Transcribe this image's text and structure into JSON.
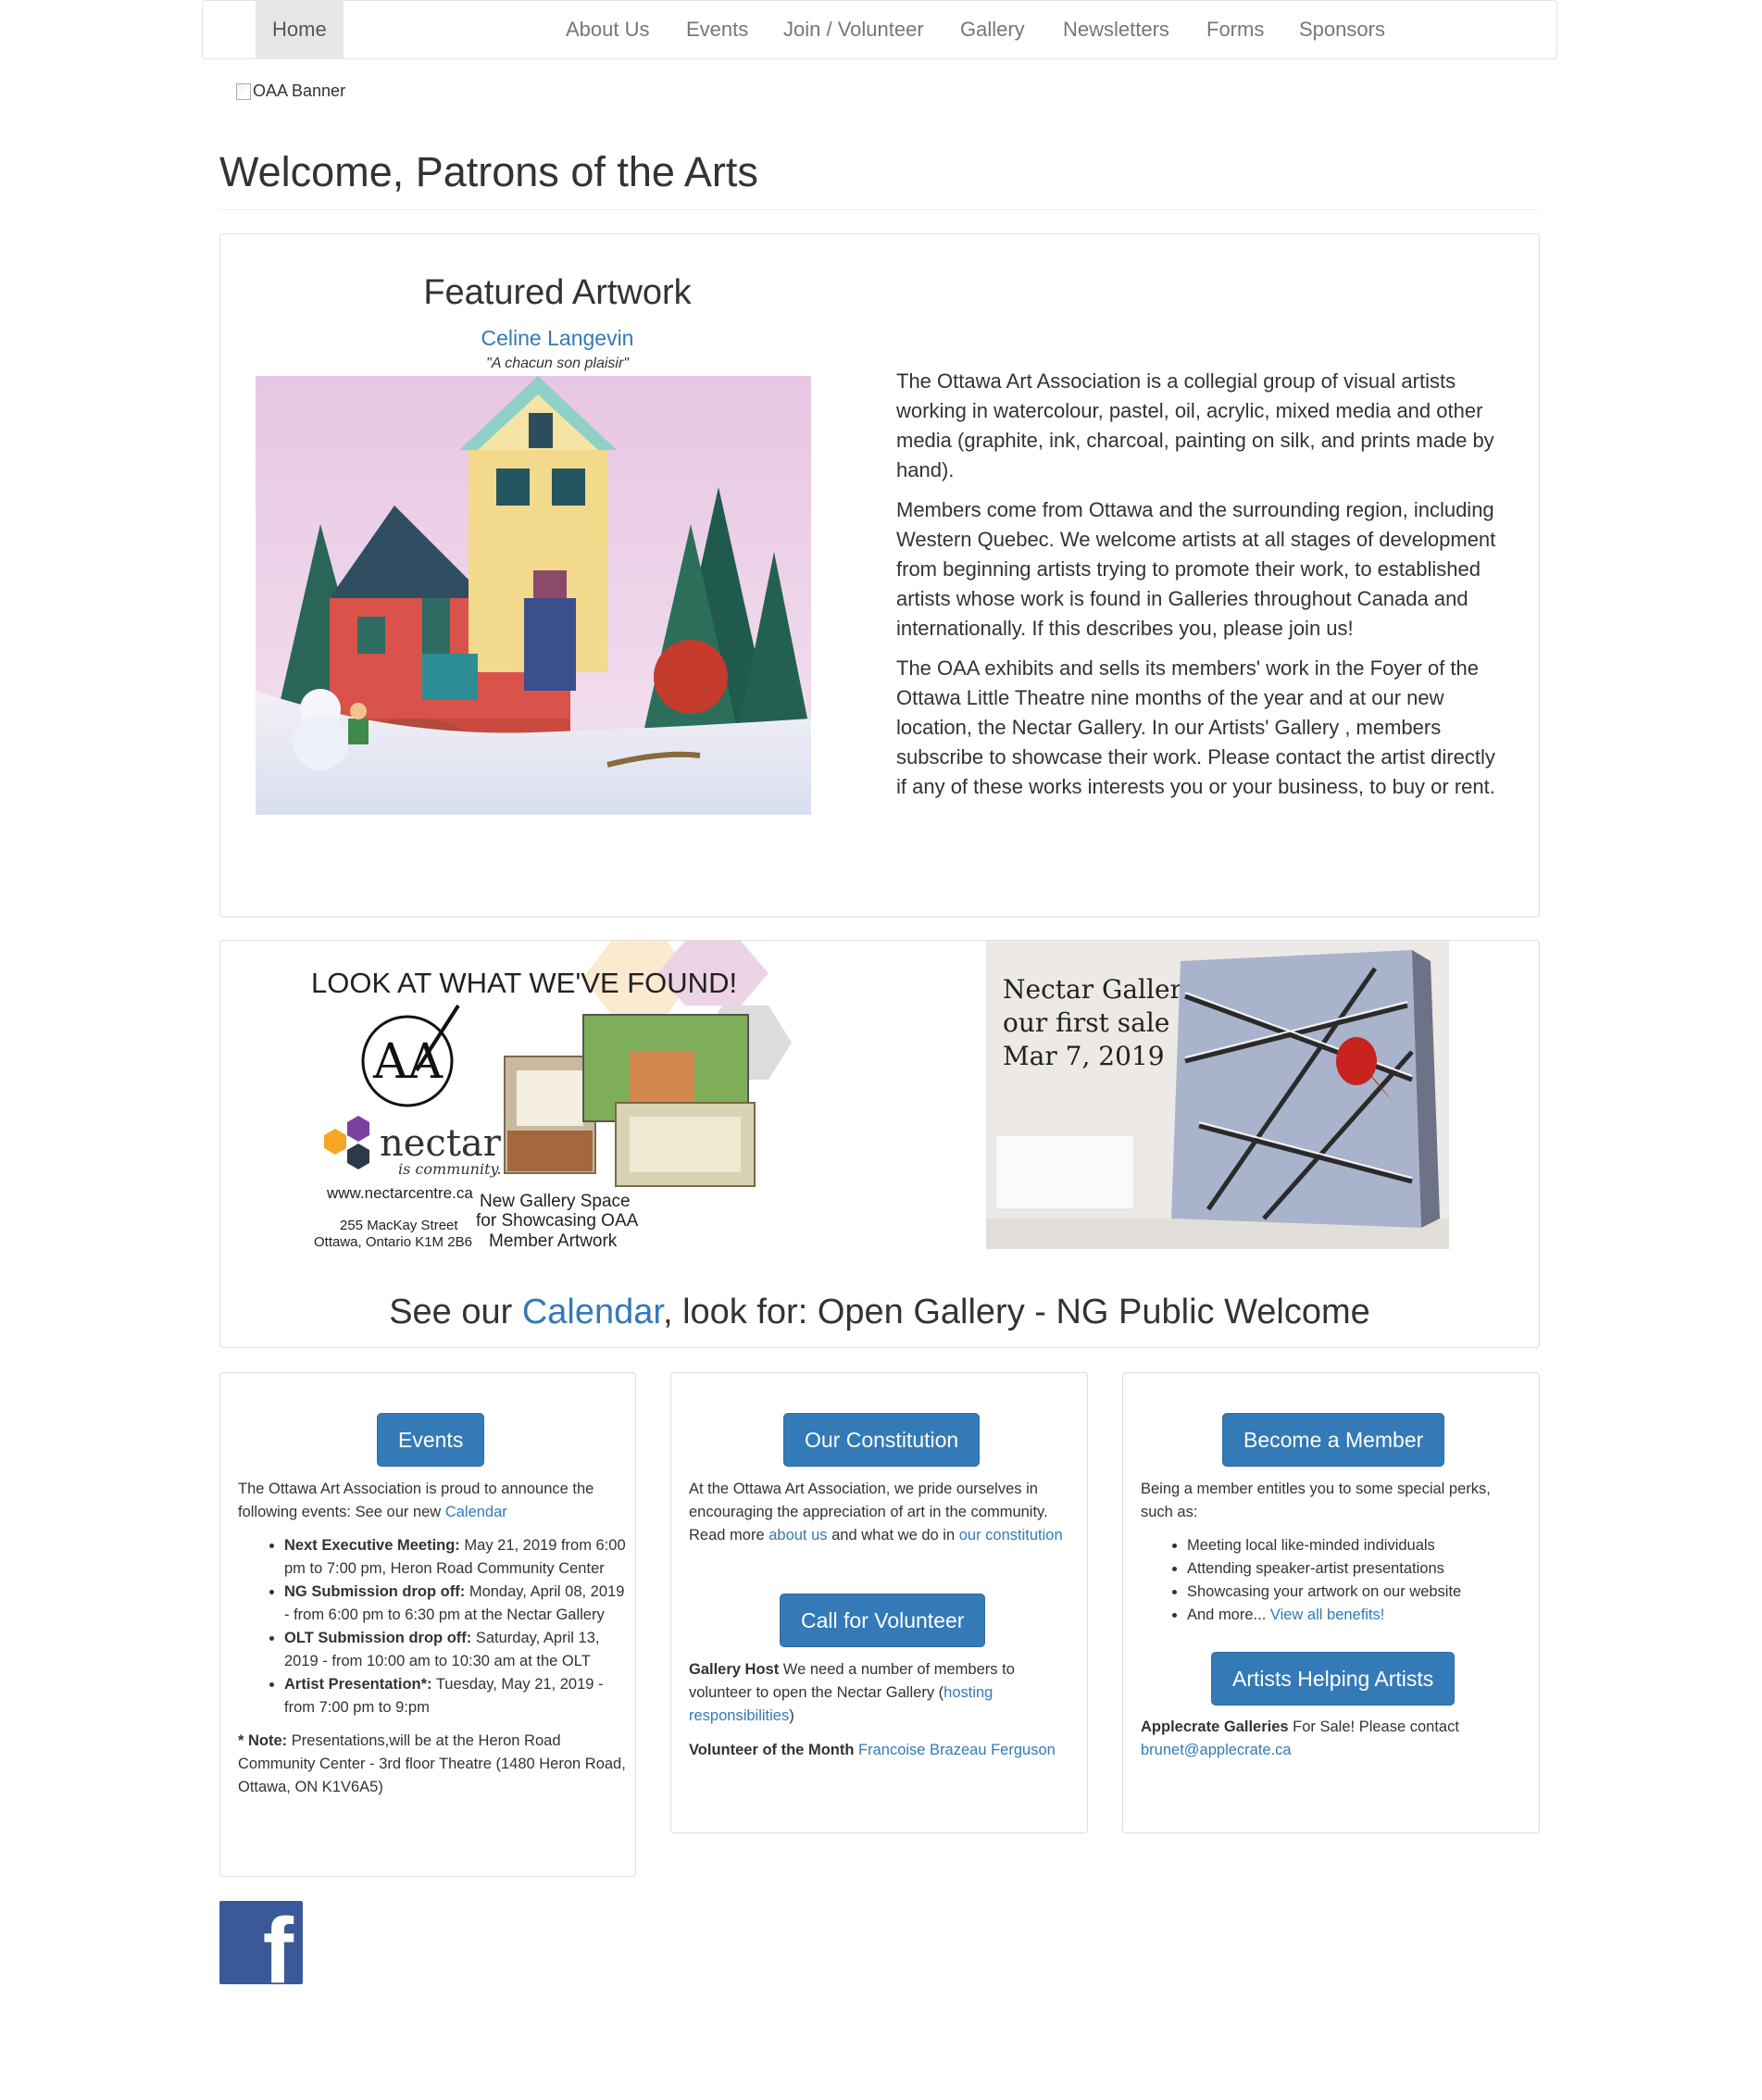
{
  "nav": {
    "items": [
      "Home",
      "About Us",
      "Events",
      "Join / Volunteer",
      "Gallery",
      "Newsletters",
      "Forms",
      "Sponsors"
    ],
    "active": "Home"
  },
  "banner": {
    "alt": "OAA Banner"
  },
  "page_title": "Welcome, Patrons of the Arts",
  "featured": {
    "heading": "Featured Artwork",
    "artist": "Celine Langevin",
    "title": "\"A chacun son plaisir\""
  },
  "about": {
    "p1": "The Ottawa Art Association is a collegial group of visual artists working in watercolour, pastel, oil, acrylic, mixed media and other media (graphite, ink, charcoal, painting on silk, and prints made by hand).",
    "p2": "Members come from Ottawa and the surrounding region, including Western Quebec. We welcome artists at all stages of development from beginning artists trying to promote their work, to established artists whose work is found in Galleries throughout Canada and internationally. If this describes you, please join us!",
    "p3_a": "The OAA exhibits and sells its members' work in the Foyer of the Ottawa Little Theatre nine months of the year and at our new location, the Nectar Gallery. In our ",
    "p3_link": "Artists' Gallery",
    "p3_b": " , members subscribe to showcase their work. Please contact the artist directly if any of these works interests you or your business, to buy or rent."
  },
  "nectar_poster": {
    "headline": "LOOK AT WHAT WE'VE FOUND!",
    "logo_letters": "AA",
    "nectar": "nectar",
    "nectar_tag": "is community.",
    "url": "www.nectarcentre.ca",
    "address_1": "255 MacKay Street",
    "address_2": "Ottawa, Ontario  K1M 2B6",
    "caption_1": "New Gallery Space",
    "caption_2": "for Showcasing OAA",
    "caption_3": "Member Artwork"
  },
  "first_sale": {
    "line1": "Nectar Gallery,",
    "line2": "our first sale",
    "line3": "Mar 7, 2019"
  },
  "calendar_line": {
    "pre": "See our ",
    "link": "Calendar",
    "post": ", look for: Open Gallery - NG Public Welcome"
  },
  "events": {
    "button": "Events",
    "intro": "The Ottawa Art Association is proud to announce the following events: See our new ",
    "intro_link": "Calendar",
    "items": [
      {
        "label": "Next Executive Meeting:",
        "text": " May 21, 2019 from 6:00 pm to 7:00 pm, Heron Road Community Center"
      },
      {
        "label": "NG Submission drop off:",
        "text": " Monday, April 08, 2019 - from 6:00 pm to 6:30 pm at the Nectar Gallery"
      },
      {
        "label": "OLT Submission drop off:",
        "text": " Saturday, April 13, 2019 - from 10:00 am to 10:30 am at the OLT"
      },
      {
        "label": "Artist Presentation*:",
        "text": " Tuesday, May 21, 2019 - from 7:00 pm to 9:pm"
      }
    ],
    "note_label": "* Note:",
    "note_text": " Presentations,will be at the Heron Road Community Center - 3rd floor Theatre (1480 Heron Road, Ottawa, ON K1V6A5)"
  },
  "constitution": {
    "button": "Our Constitution",
    "text_a": "At the Ottawa Art Association, we pride ourselves in encouraging the appreciation of art in the community. Read more ",
    "link_about": "about us",
    "text_b": " and what we do in ",
    "link_constitution": "our constitution",
    "volunteer_button": "Call for Volunteer",
    "host_label": "Gallery Host",
    "host_text": " We need a number of members to volunteer to open the Nectar Gallery (",
    "host_link": "hosting responsibilities",
    "host_end": ")",
    "vom_label": "Volunteer of the Month",
    "vom_link": "Francoise Brazeau Ferguson"
  },
  "member": {
    "button": "Become a Member",
    "intro": "Being a member entitles you to some special perks, such as:",
    "perks": [
      "Meeting local like-minded individuals",
      "Attending speaker-artist presentations",
      "Showcasing your artwork on our website",
      "And more... "
    ],
    "perks_link": "View all benefits!",
    "aha_button": "Artists Helping Artists",
    "applecrate_label": "Applecrate Galleries",
    "applecrate_text": " For Sale! Please contact",
    "applecrate_email": "brunet@applecrate.ca"
  },
  "facebook": {
    "glyph": "f"
  },
  "colors": {
    "link": "#337ab7",
    "button": "#337ab7",
    "facebook": "#3b5998"
  }
}
